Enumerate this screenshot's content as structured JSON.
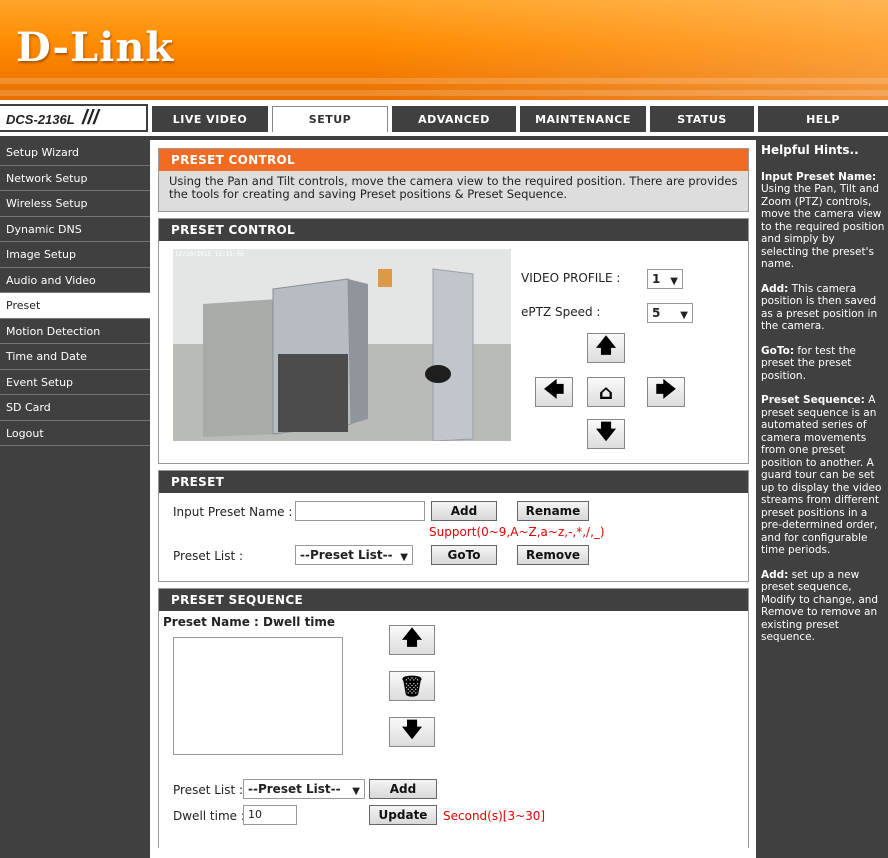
{
  "brand": {
    "logo_text": "D-Link",
    "model": "DCS-2136L",
    "slashes": "///"
  },
  "nav": {
    "tabs": [
      {
        "label": "LIVE VIDEO"
      },
      {
        "label": "SETUP"
      },
      {
        "label": "ADVANCED"
      },
      {
        "label": "MAINTENANCE"
      },
      {
        "label": "STATUS"
      },
      {
        "label": "HELP"
      }
    ],
    "active_tab": "SETUP"
  },
  "sidebar": {
    "items": [
      {
        "label": "Setup Wizard"
      },
      {
        "label": "Network Setup"
      },
      {
        "label": "Wireless Setup"
      },
      {
        "label": "Dynamic DNS"
      },
      {
        "label": "Image Setup"
      },
      {
        "label": "Audio and Video"
      },
      {
        "label": "Preset"
      },
      {
        "label": "Motion Detection"
      },
      {
        "label": "Time and Date"
      },
      {
        "label": "Event Setup"
      },
      {
        "label": "SD Card"
      },
      {
        "label": "Logout"
      }
    ],
    "active_item": "Preset"
  },
  "intro": {
    "title": "PRESET CONTROL",
    "text": "Using the Pan and Tilt controls, move the camera view to the required position. There are provides the tools for creating and saving Preset positions & Preset Sequence."
  },
  "control": {
    "title": "PRESET CONTROL",
    "video_timestamp": "12/30/2015 15:19:06",
    "video_profile_label": "VIDEO PROFILE :",
    "video_profile_value": "1",
    "eptz_speed_label": "ePTZ Speed :",
    "eptz_speed_value": "5",
    "arrows": {
      "up": "🡅",
      "down": "🡇",
      "left": "🡄",
      "right": "🡆",
      "home": "⌂"
    }
  },
  "preset": {
    "title": "PRESET",
    "input_label": "Input Preset Name :",
    "input_value": "",
    "add_label": "Add",
    "rename_label": "Rename",
    "support_text": "Support(0~9,A~Z,a~z,-,*,/,_)",
    "list_label": "Preset List :",
    "list_value": "--Preset List--",
    "goto_label": "GoTo",
    "remove_label": "Remove"
  },
  "sequence": {
    "title": "PRESET SEQUENCE",
    "name_dwell_label": "Preset Name : Dwell time",
    "list_label": "Preset List :",
    "list_value": "--Preset List--",
    "add_label": "Add",
    "dwell_label": "Dwell time :",
    "dwell_value": "10",
    "update_label": "Update",
    "seconds_text": "Second(s)[3~30]",
    "icons": {
      "up": "🡅",
      "trash": "🗑",
      "down": "🡇"
    }
  },
  "help": {
    "title": "Helpful Hints..",
    "sections": [
      {
        "heading": "Input Preset Name:",
        "text": "Using the Pan, Tilt and Zoom (PTZ) controls, move the camera view to the required position and simply by selecting the preset's name."
      },
      {
        "heading": "Add:",
        "text": "This camera position is then saved as a preset position in the camera."
      },
      {
        "heading": "GoTo:",
        "text": "for test the preset the preset position."
      },
      {
        "heading": "Preset Sequence:",
        "text": "A preset sequence is an automated series of camera movements from one preset position to another. A guard tour can be set up to display the video streams from different preset positions in a pre-determined order, and for configurable time periods."
      },
      {
        "heading": "Add:",
        "text": "set up a new preset sequence, Modify to change, and Remove to remove an existing preset sequence."
      }
    ]
  },
  "colors": {
    "orange": "#f26b22",
    "dark": "#404040",
    "red": "#e60000"
  }
}
